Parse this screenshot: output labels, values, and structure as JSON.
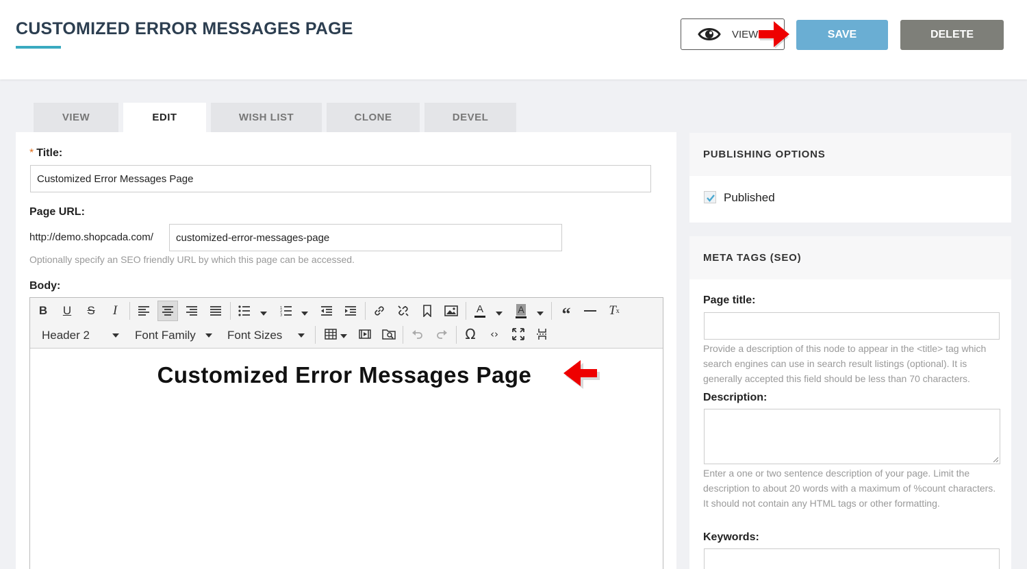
{
  "header": {
    "title": "CUSTOMIZED ERROR MESSAGES PAGE",
    "view_label": "VIEW",
    "save_label": "SAVE",
    "delete_label": "DELETE"
  },
  "tabs": [
    {
      "label": "VIEW",
      "active": false
    },
    {
      "label": "EDIT",
      "active": true
    },
    {
      "label": "WISH LIST",
      "active": false
    },
    {
      "label": "CLONE",
      "active": false
    },
    {
      "label": "DEVEL",
      "active": false
    }
  ],
  "form": {
    "title_label": "Title:",
    "title_required": "*",
    "title_value": "Customized Error Messages Page",
    "url_label": "Page URL:",
    "url_prefix": "http://demo.shopcada.com/",
    "url_value": "customized-error-messages-page",
    "url_help": "Optionally specify an SEO friendly URL by which this page can be accessed.",
    "body_label": "Body:"
  },
  "editor": {
    "block_format": "Header 2",
    "font_family": "Font Family",
    "font_sizes": "Font Sizes",
    "content_heading": "Customized Error Messages Page"
  },
  "sidebar": {
    "publishing_title": "PUBLISHING OPTIONS",
    "published_label": "Published",
    "published_checked": true,
    "meta_title": "META TAGS (SEO)",
    "page_title_label": "Page title:",
    "page_title_value": "",
    "page_title_help": "Provide a description of this node to appear in the <title> tag which search engines can use in search result listings (optional). It is generally accepted this field should be less than 70 characters.",
    "description_label": "Description:",
    "description_value": "",
    "description_help": "Enter a one or two sentence description of your page. Limit the description to about 20 words with a maximum of %count characters. It should not contain any HTML tags or other formatting.",
    "keywords_label": "Keywords:"
  },
  "colors": {
    "save": "#6aaed3",
    "delete": "#7e7f79",
    "accent": "#3aaac0",
    "arrow": "#ee0000"
  }
}
